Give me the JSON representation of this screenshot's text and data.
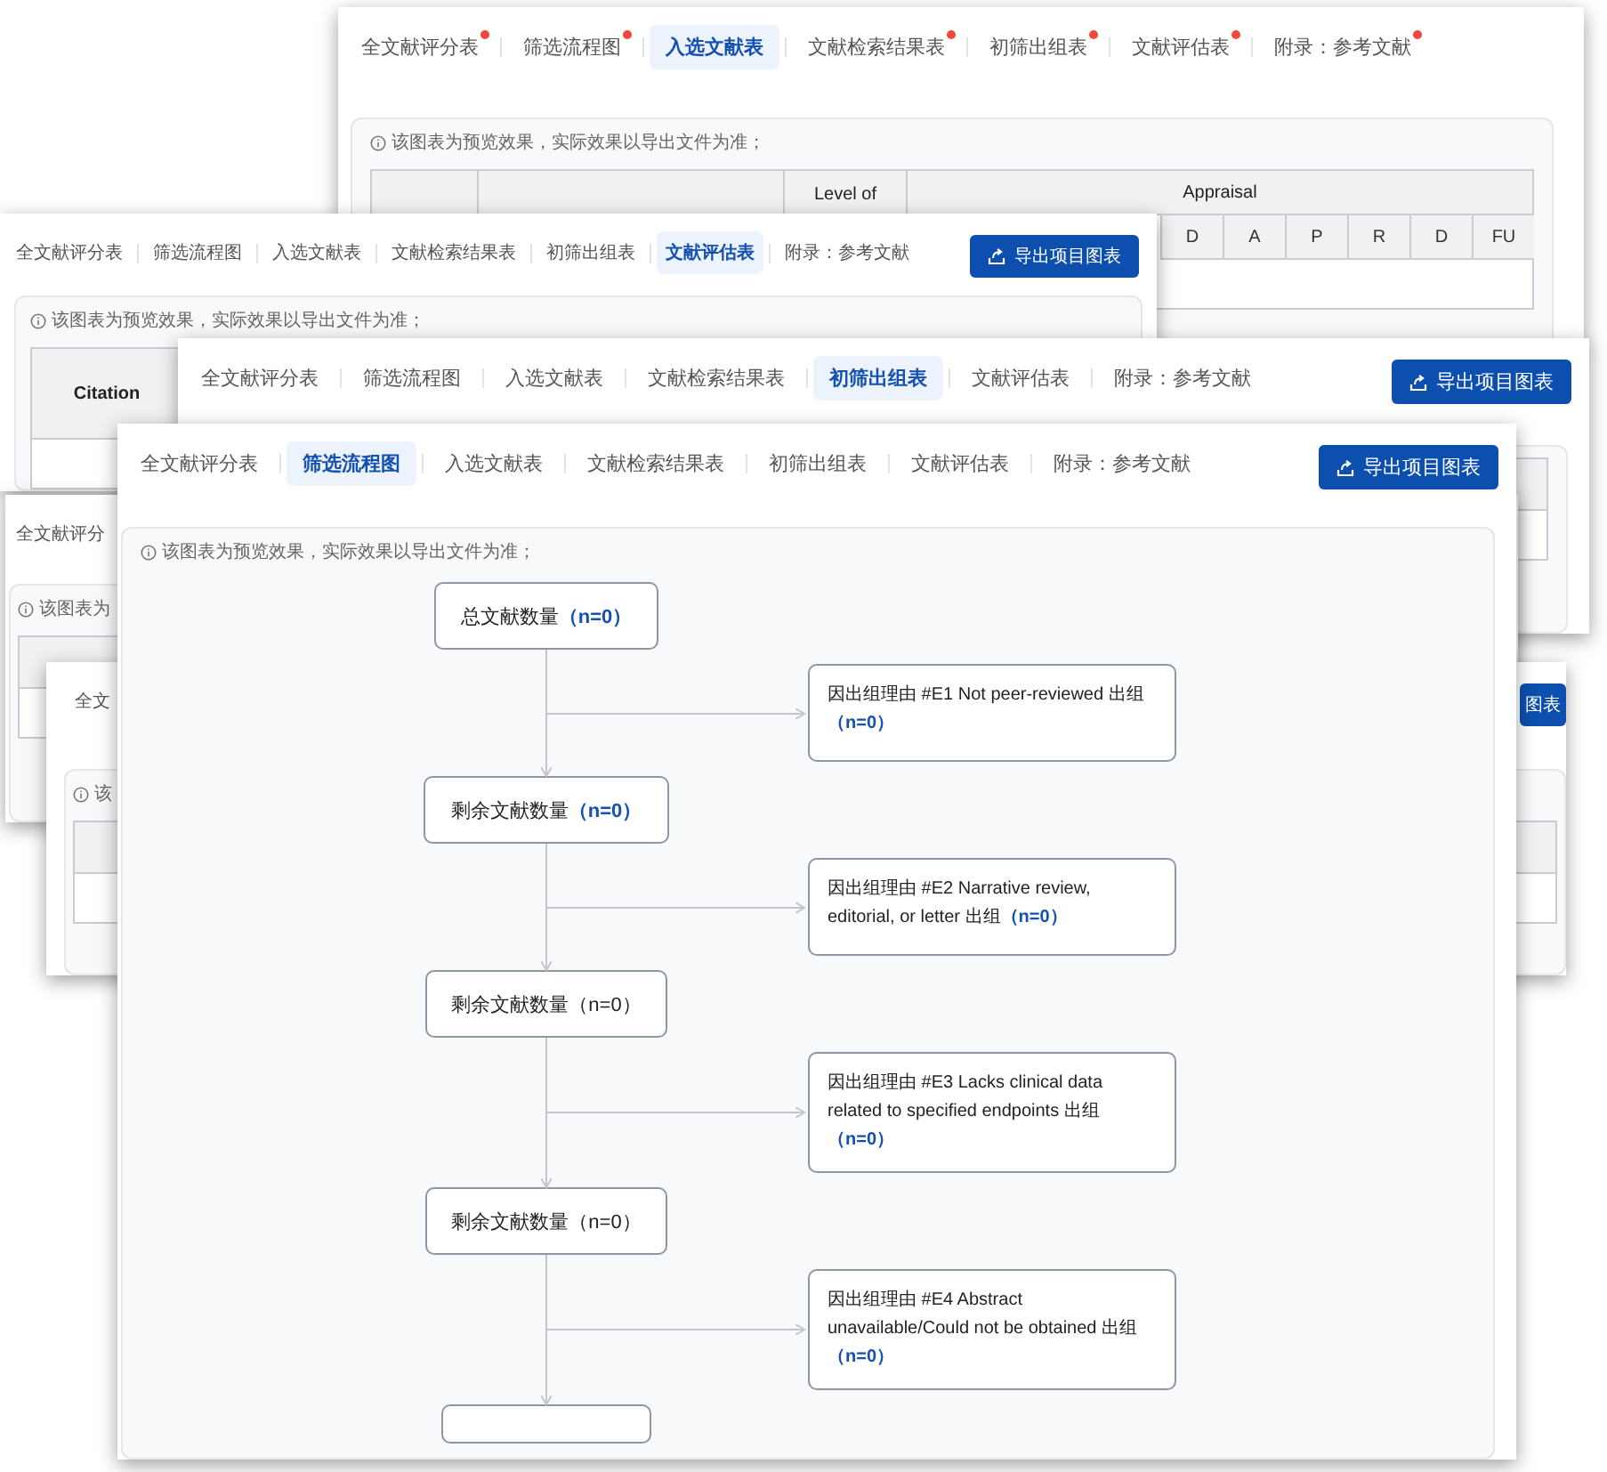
{
  "windows": [
    {
      "kind": "appraisal_table",
      "tabs": [
        {
          "label": "全文献评分表",
          "selected": false,
          "dot": true
        },
        {
          "label": "筛选流程图",
          "selected": false,
          "dot": true
        },
        {
          "label": "入选文献表",
          "selected": true,
          "dot": false
        },
        {
          "label": "文献检索结果表",
          "selected": false,
          "dot": true
        },
        {
          "label": "初筛出组表",
          "selected": false,
          "dot": true
        },
        {
          "label": "文献评估表",
          "selected": false,
          "dot": true
        },
        {
          "label": "附录：参考文献",
          "selected": false,
          "dot": true
        }
      ],
      "notice": "该图表为预览效果，实际效果以导出文件为准；",
      "table": {
        "level_header": "Level of",
        "group_header": "Appraisal",
        "subheaders": [
          "D",
          "A",
          "P",
          "R",
          "D",
          "FU"
        ]
      }
    },
    {
      "kind": "citation_table",
      "tabs": [
        {
          "label": "全文献评分表",
          "selected": false
        },
        {
          "label": "筛选流程图",
          "selected": false
        },
        {
          "label": "入选文献表",
          "selected": false
        },
        {
          "label": "文献检索结果表",
          "selected": false
        },
        {
          "label": "初筛出组表",
          "selected": false
        },
        {
          "label": "文献评估表",
          "selected": true
        },
        {
          "label": "附录：参考文献",
          "selected": false
        }
      ],
      "export_button": "导出项目图表",
      "notice": "该图表为预览效果，实际效果以导出文件为准；",
      "table": {
        "header": "Citation"
      }
    },
    {
      "kind": "grid_table",
      "tabs": [
        {
          "label": "全文献评分表",
          "selected": false
        },
        {
          "label": "筛选流程图",
          "selected": false
        },
        {
          "label": "入选文献表",
          "selected": false
        },
        {
          "label": "文献检索结果表",
          "selected": false
        },
        {
          "label": "初筛出组表",
          "selected": true
        },
        {
          "label": "文献评估表",
          "selected": false
        },
        {
          "label": "附录：参考文献",
          "selected": false
        }
      ],
      "export_button": "导出项目图表"
    },
    {
      "kind": "grid_table",
      "tabs": [
        {
          "label": "全文献评分",
          "selected": false
        }
      ],
      "notice": "该图表为"
    },
    {
      "kind": "grid_table",
      "tabs": [
        {
          "label": "全文",
          "selected": false
        }
      ],
      "export_button": "图表",
      "notice": "该"
    },
    {
      "kind": "flowchart",
      "tabs": [
        {
          "label": "全文献评分表",
          "selected": false
        },
        {
          "label": "筛选流程图",
          "selected": true
        },
        {
          "label": "入选文献表",
          "selected": false
        },
        {
          "label": "文献检索结果表",
          "selected": false
        },
        {
          "label": "初筛出组表",
          "selected": false
        },
        {
          "label": "文献评估表",
          "selected": false
        },
        {
          "label": "附录：参考文献",
          "selected": false
        }
      ],
      "export_button": "导出项目图表",
      "notice": "该图表为预览效果，实际效果以导出文件为准；",
      "flowchart": {
        "continues": true,
        "steps": [
          {
            "label": "总文献数量",
            "count": "（n=0）",
            "count_highlight": true,
            "exclusion": {
              "text": "因出组理由 #E1 Not peer-reviewed 出组",
              "count": "（n=0）"
            }
          },
          {
            "label": "剩余文献数量",
            "count": "（n=0）",
            "count_highlight": true,
            "exclusion": {
              "text": "因出组理由 #E2 Narrative review, editorial, or letter 出组",
              "count": "（n=0）"
            }
          },
          {
            "label": "剩余文献数量",
            "count": "（n=0）",
            "count_highlight": false,
            "exclusion": {
              "text": "因出组理由 #E3 Lacks clinical data related to specified endpoints 出组",
              "count": "（n=0）"
            }
          },
          {
            "label": "剩余文献数量",
            "count": "（n=0）",
            "count_highlight": false,
            "exclusion": {
              "text": "因出组理由 #E4 Abstract unavailable/Could not be obtained 出组",
              "count": "（n=0）"
            }
          }
        ]
      }
    }
  ]
}
